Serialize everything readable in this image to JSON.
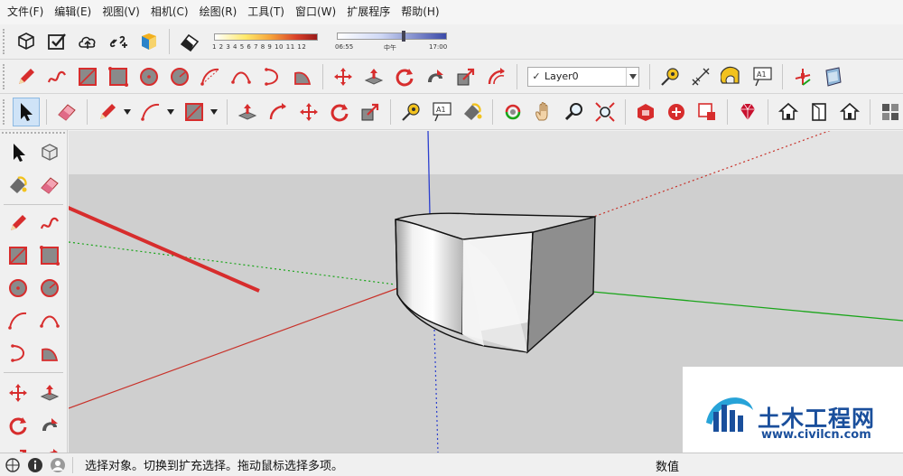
{
  "menu": {
    "items": [
      "文件(F)",
      "编辑(E)",
      "视图(V)",
      "相机(C)",
      "绘图(R)",
      "工具(T)",
      "窗口(W)",
      "扩展程序",
      "帮助(H)"
    ]
  },
  "shadow": {
    "ticks": "1 2 3 4 5 6 7 8 9 10 11 12",
    "time_start": "06:55",
    "time_mid": "中午",
    "time_end": "17:00"
  },
  "layer": {
    "name": "Layer0",
    "check": "✓"
  },
  "watermark": {
    "cn": "土木工程网",
    "url": "www.civilcn.com"
  },
  "status": {
    "hint": "选择对象。切换到扩充选择。拖动鼠标选择多项。",
    "measure_label": "数值"
  },
  "colors": {
    "accent_red": "#d72d2d",
    "axis_red": "#c8322a",
    "axis_green": "#1aa51a",
    "axis_blue": "#2b3fcf",
    "sky": "#e4e4e4",
    "ground": "#cfcfcf",
    "brand_blue": "#1a4f9c"
  },
  "icons": {
    "toolbar1": [
      "component-icon",
      "check-icon",
      "cloud-upload-icon",
      "link-add-icon",
      "warehouse-icon",
      "eraser-icon"
    ],
    "draw": [
      "pencil-icon",
      "freehand-icon",
      "rectangle-icon",
      "rotated-rectangle-icon",
      "circle-icon",
      "polygon-icon",
      "arc-icon",
      "arc-2point-icon",
      "arc-3point-icon",
      "pie-icon"
    ],
    "edit": [
      "move-icon",
      "push-pull-icon",
      "rotate-icon",
      "follow-me-icon",
      "scale-icon",
      "offset-icon"
    ],
    "construction": [
      "tape-measure-icon",
      "dimension-icon",
      "protractor-icon",
      "text-icon",
      "axes-icon"
    ]
  }
}
